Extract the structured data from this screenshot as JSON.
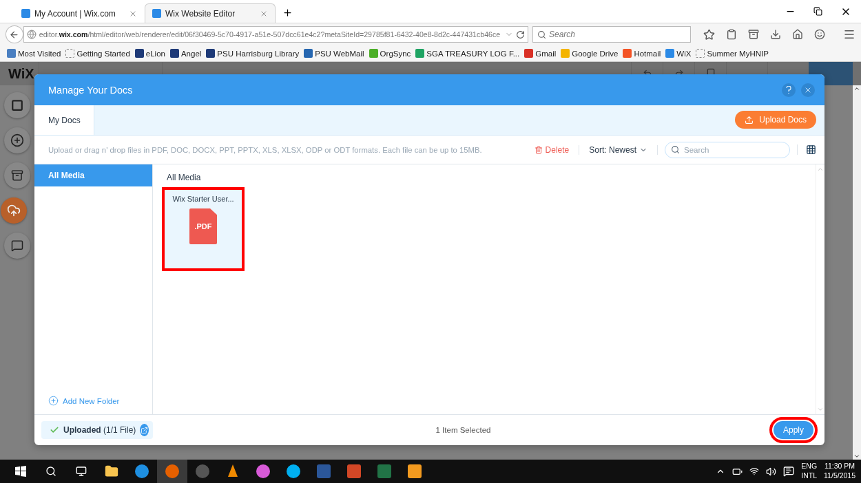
{
  "browser": {
    "tabs": [
      {
        "title": "My Account | Wix.com",
        "selected": false
      },
      {
        "title": "Wix Website Editor",
        "selected": true
      }
    ],
    "url": "editor.**wix.com**/html/editor/web/renderer/edit/06f30469-5c70-4917-a51e-507dcc61e4c2?metaSiteId=29785f81-6432-40e8-8d2c-447431cb46ce",
    "search_placeholder": "Search",
    "bookmarks": [
      {
        "label": "Most Visited",
        "kind": "search"
      },
      {
        "label": "Getting Started",
        "kind": "blank"
      },
      {
        "label": "eLion",
        "kind": "shield"
      },
      {
        "label": "Angel",
        "kind": "shield"
      },
      {
        "label": "PSU Harrisburg Library",
        "kind": "shield"
      },
      {
        "label": "PSU WebMail",
        "kind": "mail"
      },
      {
        "label": "OrgSync",
        "kind": "sync"
      },
      {
        "label": "SGA TREASURY LOG F...",
        "kind": "sheet"
      },
      {
        "label": "Gmail",
        "kind": "gmail"
      },
      {
        "label": "Google Drive",
        "kind": "drive"
      },
      {
        "label": "Hotmail",
        "kind": "windows"
      },
      {
        "label": "WiX",
        "kind": "wix"
      },
      {
        "label": "Summer MyHNIP",
        "kind": "blank"
      }
    ]
  },
  "editor": {
    "logo": "WiX"
  },
  "dialog": {
    "title": "Manage Your Docs",
    "tabs": [
      {
        "label": "My Docs",
        "selected": true
      }
    ],
    "upload_button": "Upload Docs",
    "hint": "Upload or drag n' drop files in PDF, DOC, DOCX, PPT, PPTX, XLS, XLSX, ODP or ODT formats. Each file can be up to 15MB.",
    "delete": "Delete",
    "sort": "Sort: Newest",
    "search_placeholder": "Search",
    "folders": [
      {
        "label": "All Media",
        "selected": true
      }
    ],
    "add_folder": "Add New Folder",
    "section_title": "All Media",
    "files": [
      {
        "name": "Wix Starter User...",
        "type_label": ".PDF",
        "selected": true,
        "highlighted": true
      }
    ],
    "upload_status": {
      "label": "Uploaded",
      "count": "(1/1 File)"
    },
    "selection": "1 Item Selected",
    "apply": {
      "label": "Apply",
      "highlighted": true
    }
  },
  "taskbar": {
    "language": [
      "ENG",
      "INTL"
    ],
    "time": "11:30 PM",
    "date": "11/5/2015"
  }
}
